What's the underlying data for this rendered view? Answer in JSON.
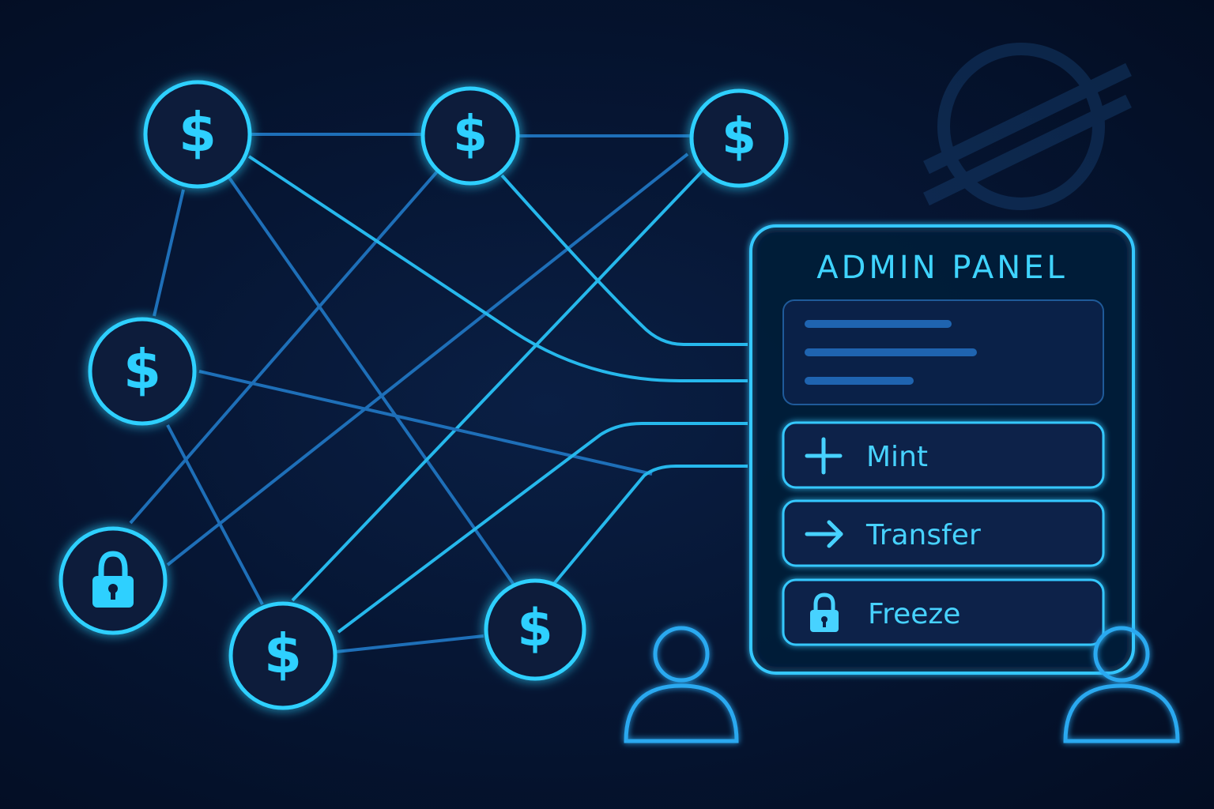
{
  "panel": {
    "title": "ADMIN PANEL",
    "actions": [
      {
        "label": "Mint",
        "icon": "plus-icon"
      },
      {
        "label": "Transfer",
        "icon": "arrow-right-icon"
      },
      {
        "label": "Freeze",
        "icon": "lock-icon"
      }
    ]
  },
  "nodes": [
    {
      "id": "n1",
      "icon": "dollar-icon",
      "glyph": "$"
    },
    {
      "id": "n2",
      "icon": "dollar-icon",
      "glyph": "$"
    },
    {
      "id": "n3",
      "icon": "dollar-icon",
      "glyph": "$"
    },
    {
      "id": "n4",
      "icon": "dollar-icon",
      "glyph": "$"
    },
    {
      "id": "n5",
      "icon": "lock-icon",
      "glyph": ""
    },
    {
      "id": "n6",
      "icon": "dollar-icon",
      "glyph": "$"
    },
    {
      "id": "n7",
      "icon": "dollar-icon",
      "glyph": "$"
    }
  ],
  "users": [
    {
      "icon": "user-icon"
    },
    {
      "icon": "user-icon"
    }
  ],
  "logo": {
    "icon": "stellar-logo-icon"
  },
  "colors": {
    "background": "#04122a",
    "accent": "#2ed0ff",
    "line_dim": "#1e6fb8",
    "line_bright": "#26b8ec",
    "panel_border": "#35c8ff"
  }
}
